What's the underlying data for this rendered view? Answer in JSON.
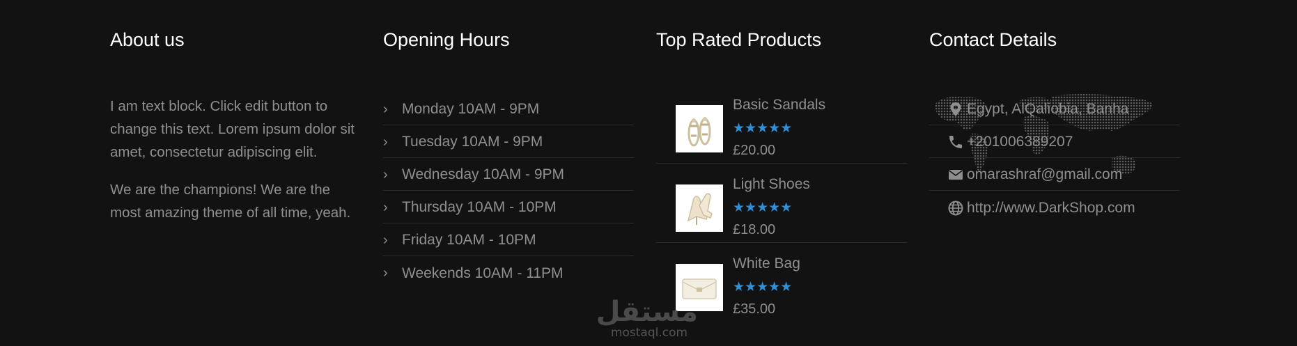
{
  "about": {
    "title": "About us",
    "paragraph1": "I am text block. Click edit button to change this text. Lorem ipsum dolor sit amet, consectetur adipiscing elit.",
    "paragraph2": "We are the champions! We are the most amazing theme of all time, yeah."
  },
  "hours": {
    "title": "Opening Hours",
    "bullet": "›",
    "items": [
      {
        "label": "Monday 10AM - 9PM"
      },
      {
        "label": "Tuesday 10AM - 9PM"
      },
      {
        "label": "Wednesday 10AM - 9PM"
      },
      {
        "label": "Thursday 10AM - 10PM"
      },
      {
        "label": "Friday 10AM - 10PM"
      },
      {
        "label": "Weekends 10AM - 11PM"
      }
    ]
  },
  "products": {
    "title": "Top Rated Products",
    "star_color": "#2f8fd8",
    "items": [
      {
        "name": "Basic Sandals",
        "stars": "★★★★★",
        "rating": 5,
        "price": "£20.00",
        "image_icon": "sandals-icon"
      },
      {
        "name": "Light Shoes",
        "stars": "★★★★★",
        "rating": 5,
        "price": "£18.00",
        "image_icon": "heels-icon"
      },
      {
        "name": "White Bag",
        "stars": "★★★★★",
        "rating": 5,
        "price": "£35.00",
        "image_icon": "bag-icon"
      }
    ]
  },
  "contact": {
    "title": "Contact Details",
    "address": "Egypt, AlQaliobia, Banha",
    "phone": "+201006389207",
    "email": "omarashraf@gmail.com",
    "website": "http://www.DarkShop.com",
    "icons": [
      "map-marker-icon",
      "phone-icon",
      "envelope-icon",
      "globe-icon"
    ]
  },
  "watermark": {
    "arabic": "مستقل",
    "latin": "mostaql.com"
  }
}
